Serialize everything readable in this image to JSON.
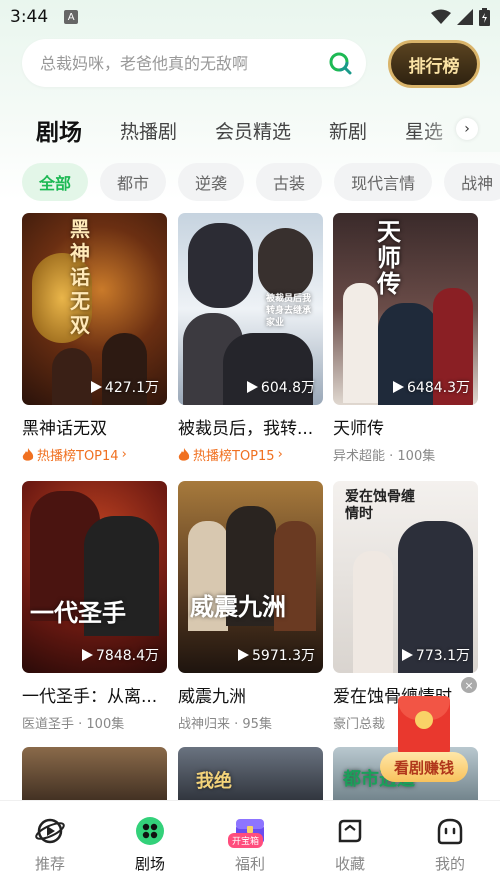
{
  "status_bar": {
    "time": "3:44",
    "notification_icon": "A"
  },
  "search": {
    "placeholder": "总裁妈咪，老爸他真的无敌啊"
  },
  "rank_button": {
    "label": "排行榜"
  },
  "tabs": [
    {
      "label": "剧场",
      "active": true
    },
    {
      "label": "热播剧",
      "active": false
    },
    {
      "label": "会员精选",
      "active": false
    },
    {
      "label": "新剧",
      "active": false
    },
    {
      "label": "星选",
      "active": false
    }
  ],
  "chips": [
    {
      "label": "全部",
      "active": true
    },
    {
      "label": "都市",
      "active": false
    },
    {
      "label": "逆袭",
      "active": false
    },
    {
      "label": "古装",
      "active": false
    },
    {
      "label": "现代言情",
      "active": false
    },
    {
      "label": "战神",
      "active": false
    }
  ],
  "cards": [
    {
      "title": "黑神话无双",
      "views": "427.1万",
      "sub": "热播榜TOP14",
      "hot": true,
      "poster_text": "黑神话无双"
    },
    {
      "title": "被裁员后，我转...",
      "views": "604.8万",
      "sub": "热播榜TOP15",
      "hot": true,
      "poster_text": "被裁员后我转身去继承家业"
    },
    {
      "title": "天师传",
      "views": "6484.3万",
      "sub": "异术超能 · 100集",
      "hot": false,
      "poster_text": "天师传"
    },
    {
      "title": "一代圣手：从离...",
      "views": "7848.4万",
      "sub": "医道圣手 · 100集",
      "hot": false,
      "poster_text": "一代圣手"
    },
    {
      "title": "威震九洲",
      "views": "5971.3万",
      "sub": "战神归来 · 95集",
      "hot": false,
      "poster_text": "威震九洲"
    },
    {
      "title": "爱在蚀骨缠情时",
      "views": "773.1万",
      "sub": "豪门总裁",
      "hot": false,
      "poster_text": "爱在蚀骨缠情时"
    },
    {
      "title": "",
      "views": "",
      "sub": "",
      "hot": false,
      "poster_text": ""
    },
    {
      "title": "",
      "views": "",
      "sub": "",
      "hot": false,
      "poster_text": "我绝"
    },
    {
      "title": "",
      "views": "",
      "sub": "",
      "hot": false,
      "poster_text": "都市逍遥"
    }
  ],
  "float_widget": {
    "label": "看剧赚钱"
  },
  "bottom_nav": [
    {
      "label": "推荐",
      "icon": "planet-icon",
      "active": false
    },
    {
      "label": "剧场",
      "icon": "theater-icon",
      "active": true
    },
    {
      "label": "福利",
      "icon": "treasure-icon",
      "active": false,
      "badge": "开宝箱"
    },
    {
      "label": "收藏",
      "icon": "bookmark-icon",
      "active": false
    },
    {
      "label": "我的",
      "icon": "profile-icon",
      "active": false
    }
  ],
  "colors": {
    "accent": "#1db954",
    "hot": "#f07020",
    "rank_gold": "#d9b46a"
  }
}
